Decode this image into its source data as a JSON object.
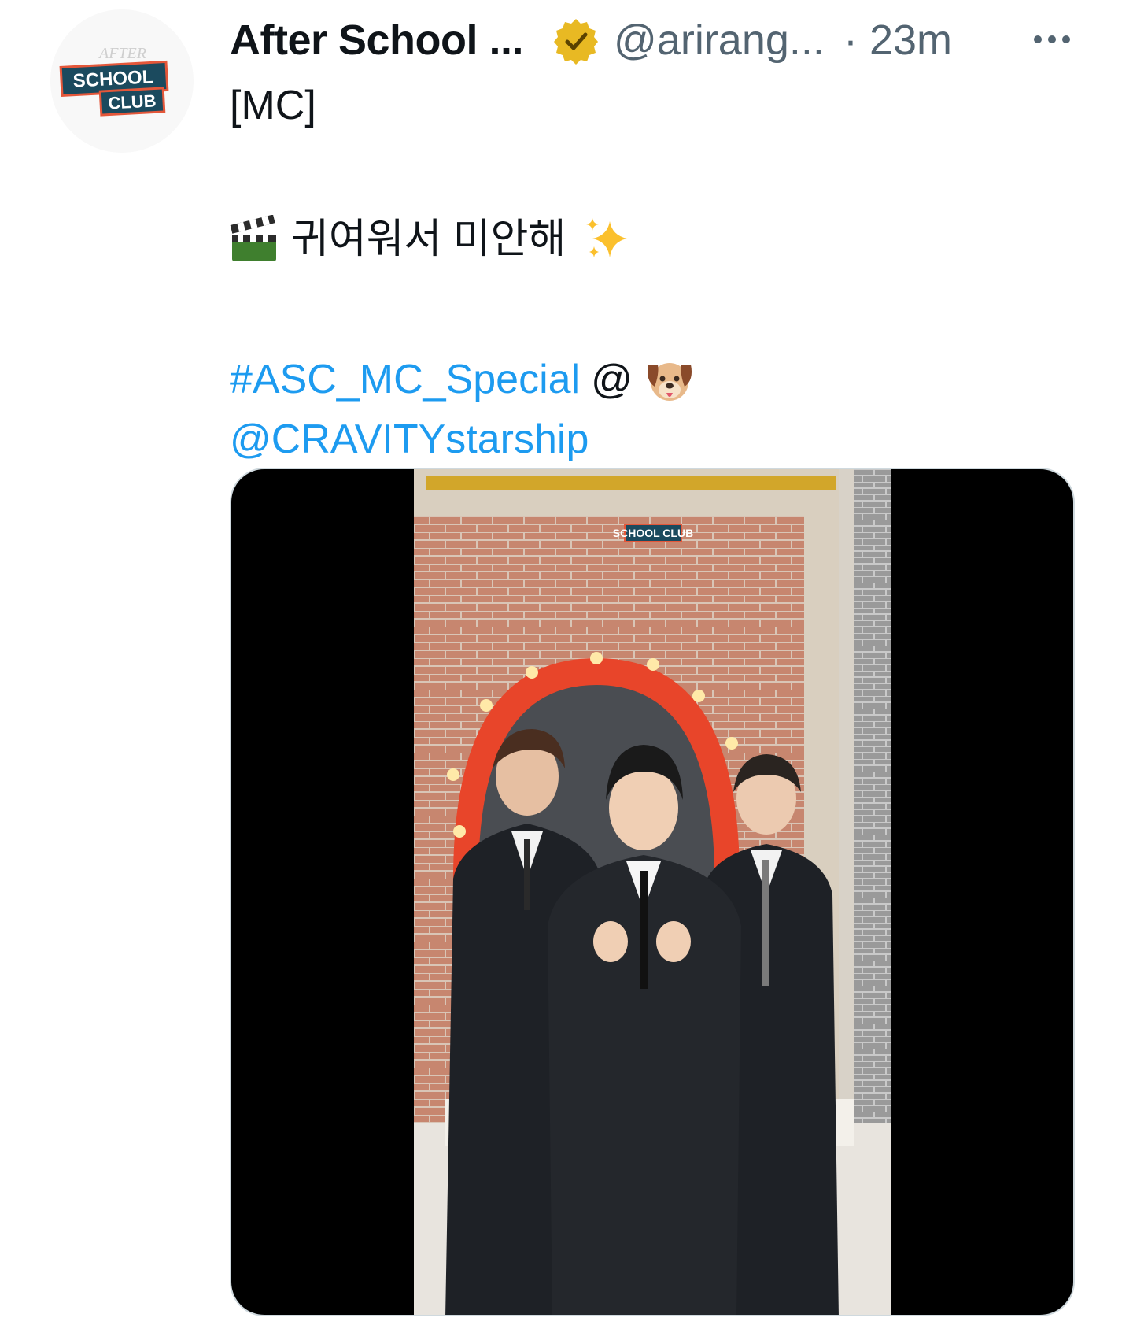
{
  "author": {
    "display_name": "After School ...",
    "handle": "@arirang...",
    "time": "· 23m",
    "verified": true,
    "avatar_icon": "after-school-club-logo"
  },
  "tweet": {
    "line1": "[MC]",
    "line2_emoji_before": "clapper-board-icon",
    "line2_text": "귀여워서 미안해",
    "line2_emoji_after": "sparkles-icon",
    "hashtag": "#ASC_MC_Special",
    "at_sign": "@",
    "dog_emoji": "dog-face-icon",
    "mention": "@CRAVITYstarship"
  },
  "media": {
    "type": "video",
    "scene_logo_text": "SCHOOL CLUB"
  },
  "colors": {
    "link": "#1d9bf0",
    "secondary_text": "#536471",
    "badge": "#e8b923",
    "brick": "#c8826a",
    "arch": "#e8452a"
  }
}
